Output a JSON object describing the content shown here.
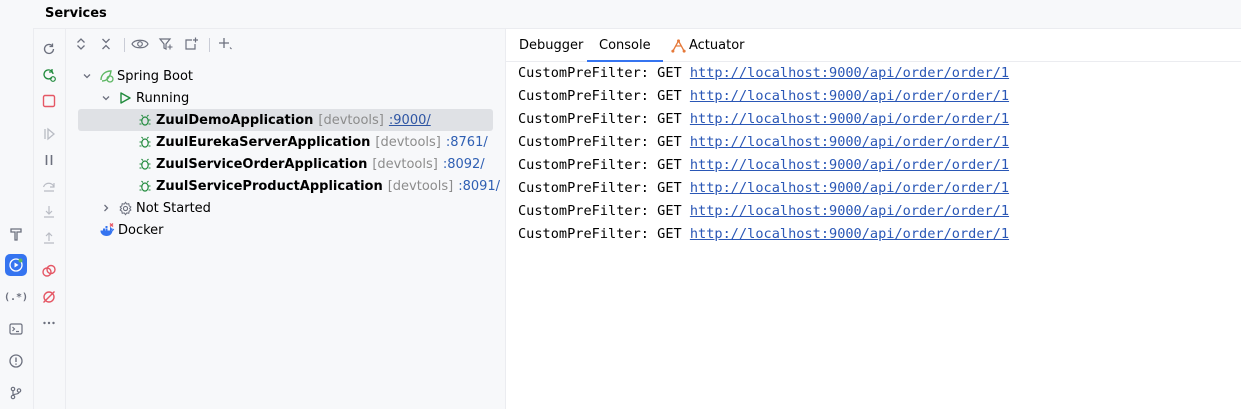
{
  "window": {
    "title": "Services"
  },
  "toolstrip": {
    "icons": [
      "hammer-icon",
      "services-icon",
      "regex-icon",
      "terminal-icon",
      "problems-icon",
      "git-icon"
    ]
  },
  "actions": {
    "icons": [
      "rerun-icon",
      "rerun-failed-icon",
      "stop-icon",
      "resume-icon",
      "pause-icon",
      "step-over-icon",
      "step-into-icon",
      "step-out-icon",
      "view-breakpoints-icon",
      "mute-breakpoints-icon",
      "more-icon"
    ]
  },
  "tree_toolbar": {
    "icons": [
      "expand-all-icon",
      "collapse-all-icon",
      "eye-icon",
      "filter-icon",
      "new-tab-icon",
      "add-icon"
    ]
  },
  "tree": {
    "spring_boot": {
      "label": "Spring Boot"
    },
    "running": {
      "label": "Running"
    },
    "apps": [
      {
        "name": "ZuulDemoApplication",
        "tag": "[devtools]",
        "port": ":9000/",
        "selected": true
      },
      {
        "name": "ZuulEurekaServerApplication",
        "tag": "[devtools]",
        "port": ":8761/",
        "selected": false
      },
      {
        "name": "ZuulServiceOrderApplication",
        "tag": "[devtools]",
        "port": ":8092/",
        "selected": false
      },
      {
        "name": "ZuulServiceProductApplication",
        "tag": "[devtools]",
        "port": ":8091/",
        "selected": false
      }
    ],
    "not_started": {
      "label": "Not Started"
    },
    "docker": {
      "label": "Docker"
    }
  },
  "tabs": [
    {
      "label": "Debugger",
      "active": false
    },
    {
      "label": "Console",
      "active": true
    },
    {
      "label": "Actuator",
      "active": false
    }
  ],
  "console": {
    "lines": [
      {
        "prefix": "CustomPreFilter: GET ",
        "url": "http://localhost:9000/api/order/order/1"
      },
      {
        "prefix": "CustomPreFilter: GET ",
        "url": "http://localhost:9000/api/order/order/1"
      },
      {
        "prefix": "CustomPreFilter: GET ",
        "url": "http://localhost:9000/api/order/order/1"
      },
      {
        "prefix": "CustomPreFilter: GET ",
        "url": "http://localhost:9000/api/order/order/1"
      },
      {
        "prefix": "CustomPreFilter: GET ",
        "url": "http://localhost:9000/api/order/order/1"
      },
      {
        "prefix": "CustomPreFilter: GET ",
        "url": "http://localhost:9000/api/order/order/1"
      },
      {
        "prefix": "CustomPreFilter: GET ",
        "url": "http://localhost:9000/api/order/order/1"
      },
      {
        "prefix": "CustomPreFilter: GET ",
        "url": "http://localhost:9000/api/order/order/1"
      }
    ]
  },
  "colors": {
    "accent": "#3574f0",
    "run_green": "#208a3c",
    "stop_red": "#e55765",
    "link": "#2a57b6"
  }
}
